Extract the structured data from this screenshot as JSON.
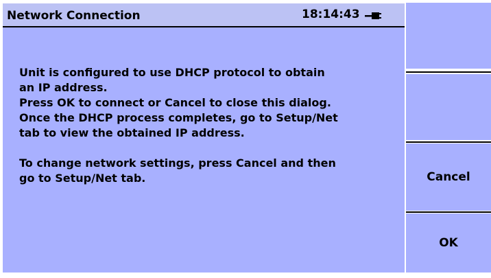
{
  "dialog": {
    "title": "Network Connection",
    "time": "18:14:43",
    "connection_icon": "network-plug-icon",
    "message_lines": [
      "Unit is configured to use DHCP protocol to obtain",
      "an IP address.",
      "Press OK to connect or Cancel to close this dialog.",
      "Once the DHCP process completes, go to Setup/Net",
      "tab to view the obtained IP address.",
      "",
      "To change network settings, press Cancel and then",
      "go to Setup/Net tab."
    ]
  },
  "softkeys": {
    "key1": "",
    "key2": "",
    "cancel": "Cancel",
    "ok": "OK"
  },
  "colors": {
    "panel": "#a8b0ff",
    "titlebar": "#bcc2f4",
    "text": "#000000"
  }
}
